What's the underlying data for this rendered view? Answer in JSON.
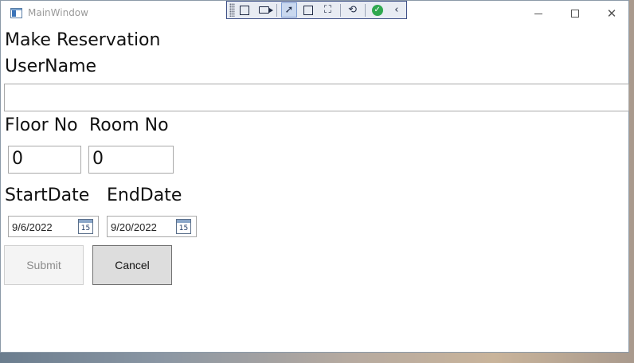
{
  "window": {
    "title": "MainWindow",
    "controls": {
      "minimize_icon": "minimize-icon",
      "maximize_icon": "maximize-icon",
      "close_icon": "close-icon",
      "close_glyph": "✕"
    }
  },
  "debug_toolbar": {
    "tools": [
      "select-element-icon",
      "track-focus-icon",
      "select-element-active-icon",
      "show-layout-adorners-icon",
      "display-layout-icon",
      "hot-reload-icon",
      "binding-check-icon",
      "collapse-chevron-icon"
    ],
    "checked_glyph": "✓",
    "collapse_glyph": "‹"
  },
  "form": {
    "heading": "Make Reservation",
    "username_label": "UserName",
    "username_value": "",
    "floor_label": "Floor No",
    "room_label": "Room No",
    "floor_value": "0",
    "room_value": "0",
    "start_label": "StartDate",
    "end_label": "EndDate",
    "start_date": "9/6/2022",
    "end_date": "9/20/2022",
    "calendar_day": "15",
    "submit_label": "Submit",
    "cancel_label": "Cancel",
    "submit_enabled": false
  }
}
